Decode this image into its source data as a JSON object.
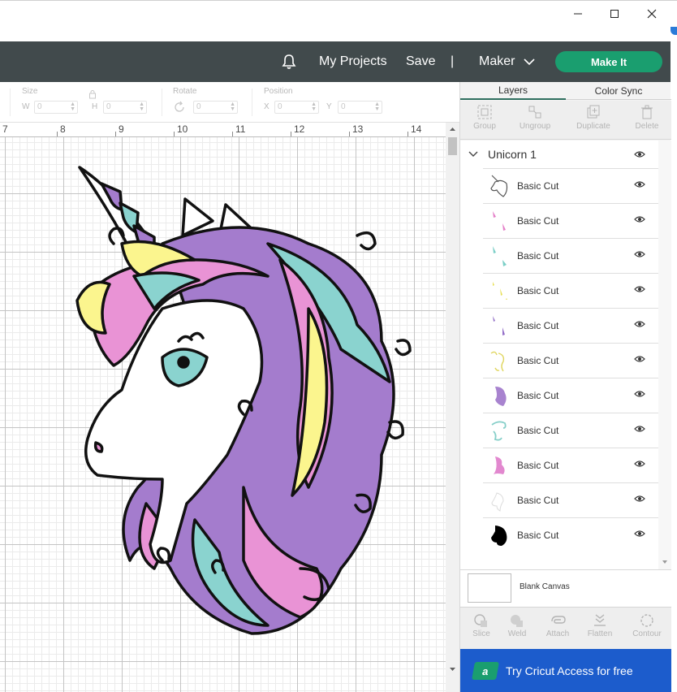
{
  "window": {
    "controls": [
      "minimize",
      "maximize",
      "close"
    ]
  },
  "header": {
    "my_projects": "My Projects",
    "save": "Save",
    "separator": "|",
    "machine": "Maker",
    "make_it": "Make It"
  },
  "toolbar": {
    "size_label": "Size",
    "w_label": "W",
    "h_label": "H",
    "w_value": "0",
    "h_value": "0",
    "rotate_label": "Rotate",
    "rotate_value": "0",
    "position_label": "Position",
    "x_label": "X",
    "y_label": "Y",
    "x_value": "0",
    "y_value": "0"
  },
  "ruler": {
    "numbers": [
      "7",
      "8",
      "9",
      "10",
      "11",
      "12",
      "13",
      "14"
    ]
  },
  "panel": {
    "tabs": {
      "layers": "Layers",
      "color_sync": "Color Sync"
    },
    "tools": {
      "group": "Group",
      "ungroup": "Ungroup",
      "duplicate": "Duplicate",
      "delete": "Delete"
    },
    "group_name": "Unicorn 1",
    "layers": [
      {
        "name": "Basic Cut",
        "thumb": "unicorn-line-art",
        "color": "#555555"
      },
      {
        "name": "Basic Cut",
        "thumb": "pink-pieces",
        "color": "#e47fc8"
      },
      {
        "name": "Basic Cut",
        "thumb": "teal-pieces",
        "color": "#7ccfc7"
      },
      {
        "name": "Basic Cut",
        "thumb": "yellow-pieces",
        "color": "#e8e05a"
      },
      {
        "name": "Basic Cut",
        "thumb": "purple-pieces",
        "color": "#9470c8"
      },
      {
        "name": "Basic Cut",
        "thumb": "yellow-mane",
        "color": "#e0d660"
      },
      {
        "name": "Basic Cut",
        "thumb": "purple-mane",
        "color": "#a883cf"
      },
      {
        "name": "Basic Cut",
        "thumb": "teal-mane",
        "color": "#86cfc9"
      },
      {
        "name": "Basic Cut",
        "thumb": "pink-mane",
        "color": "#e288cf"
      },
      {
        "name": "Basic Cut",
        "thumb": "white-face",
        "color": "#dcdcdc"
      },
      {
        "name": "Basic Cut",
        "thumb": "black-silhouette",
        "color": "#000000"
      }
    ],
    "blank_canvas": "Blank Canvas",
    "bottom_tools": {
      "slice": "Slice",
      "weld": "Weld",
      "attach": "Attach",
      "flatten": "Flatten",
      "contour": "Contour"
    },
    "access_cta": "Try Cricut Access for free",
    "access_icon_letter": "a"
  },
  "colors": {
    "topbar": "#414a4c",
    "make_it": "#1a9e6f",
    "access": "#1c5ccc",
    "pink": "#e993d5",
    "purple": "#a47ccd",
    "teal": "#8ad3cf",
    "yellow": "#fbf58e"
  }
}
